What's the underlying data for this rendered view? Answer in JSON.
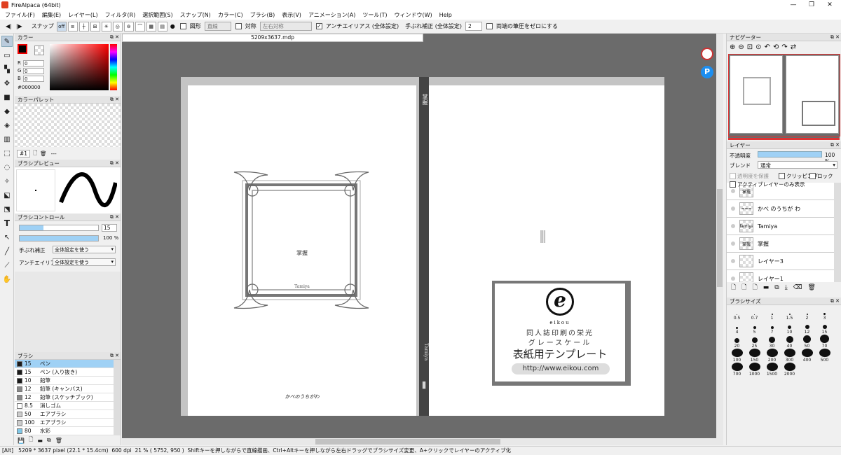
{
  "window": {
    "title": "FireAlpaca (64bit)",
    "min": "—",
    "restore": "❐",
    "close": "✕"
  },
  "menu": [
    "ファイル(F)",
    "編集(E)",
    "レイヤー(L)",
    "フィルタ(R)",
    "選択範囲(S)",
    "スナップ(N)",
    "カラー(C)",
    "ブラシ(B)",
    "表示(V)",
    "アニメーション(A)",
    "ツール(T)",
    "ウィンドウ(W)",
    "Help"
  ],
  "toolbar": {
    "snap_label": "スナップ",
    "shape_label": "図形",
    "shape_value": "直線",
    "sym_label": "対称",
    "sym_value": "左右対称",
    "aa_label": "アンチエイリアス (全体設定)",
    "stab_label": "手ぶれ補正 (全体設定)",
    "stab_value": "2",
    "pressure_label": "両端の筆圧をゼロにする"
  },
  "doc_tab": "5209x3637.mdp",
  "color_panel": {
    "title": "カラー",
    "r_label": "R",
    "r": "0",
    "g_label": "G",
    "g": "0",
    "b_label": "B",
    "b": "0",
    "hex": "#000000",
    "fg_color": "#000000"
  },
  "palette_panel": {
    "title": "カラーパレット",
    "selector": "#1",
    "name": "---"
  },
  "brush_preview": {
    "title": "ブラシプレビュー"
  },
  "brush_control": {
    "title": "ブラシコントロール",
    "size": "15",
    "opacity": "100 %",
    "size_fill": 0.3,
    "opacity_fill": 1.0,
    "stab_label": "手ぶれ補正",
    "stab_value": "全体設定を使う",
    "aa_label": "アンチエイリアス",
    "aa_value": "全体設定を使う"
  },
  "brush_panel": {
    "title": "ブラシ",
    "items": [
      {
        "size": "15",
        "name": "ペン",
        "color": "#1a1a1a",
        "selected": true
      },
      {
        "size": "15",
        "name": "ペン (入り抜き)",
        "color": "#1a1a1a"
      },
      {
        "size": "10",
        "name": "鉛筆",
        "color": "#1a1a1a"
      },
      {
        "size": "12",
        "name": "鉛筆 (キャンバス)",
        "color": "#888888"
      },
      {
        "size": "12",
        "name": "鉛筆 (スケッチブック)",
        "color": "#888888"
      },
      {
        "size": "8.5",
        "name": "消しゴム",
        "color": "#ffffff"
      },
      {
        "size": "50",
        "name": "エアブラシ",
        "color": "#cccccc"
      },
      {
        "size": "100",
        "name": "エアブラシ",
        "color": "#cccccc"
      },
      {
        "size": "80",
        "name": "水彩",
        "color": "#7fc8e8"
      }
    ]
  },
  "canvas": {
    "spine_title": "掌握",
    "spine_author": "Tamiya",
    "front_title": "掌握",
    "front_author": "Tamiya",
    "signature": "かべのうちがわ",
    "eikou_brand": "eikou",
    "eikou_line1": "同人誌印刷の栄光",
    "eikou_line2": "グレースケール",
    "eikou_line3": "表紙用テンプレート",
    "eikou_url": "http://www.eikou.com",
    "barcode_mark": "⫼"
  },
  "navigator": {
    "title": "ナビゲーター",
    "buttons": [
      "zoom-in",
      "zoom-out",
      "zoom-fit",
      "zoom-actual",
      "rotate-left",
      "rotate-reset",
      "rotate-right",
      "flip"
    ],
    "glyphs": [
      "⊕",
      "⊖",
      "⊡",
      "⊙",
      "↶",
      "⟲",
      "↷",
      "⇄"
    ]
  },
  "layer_panel": {
    "title": "レイヤー",
    "opacity_label": "不透明度",
    "opacity_value": "100 %",
    "blend_label": "ブレンド",
    "blend_value": "通常",
    "protect_label": "透明度を保護",
    "clip_label": "クリッピング",
    "lock_label": "ロック",
    "active_only_label": "アクティブレイヤーのみ表示",
    "layers": [
      {
        "name": "",
        "thumb": "掌握"
      },
      {
        "name": "かべ のうちが わ",
        "thumb": "≈≈≈"
      },
      {
        "name": "Tamiya",
        "thumb": "Tamiya"
      },
      {
        "name": "掌握",
        "thumb": "掌握"
      },
      {
        "name": "レイヤー3",
        "thumb": ""
      },
      {
        "name": "レイヤー1",
        "thumb": ""
      }
    ]
  },
  "brush_size_panel": {
    "title": "ブラシサイズ",
    "sizes": [
      "0.5",
      "0.7",
      "1",
      "1.5",
      "2",
      "3",
      "4",
      "5",
      "7",
      "10",
      "12",
      "15",
      "20",
      "25",
      "30",
      "40",
      "50",
      "70",
      "100",
      "150",
      "200",
      "300",
      "400",
      "500",
      "700",
      "1000",
      "1500",
      "2000"
    ]
  },
  "status": {
    "mode": "[Alt]",
    "size": "5209 * 3637 pixel",
    "cm": "(22.1 * 15.4cm)",
    "dpi": "600 dpi",
    "zoom": "21 %",
    "coords": "( 5752, 950 )",
    "hint": "Shiftキーを押しながらで直線描画、Ctrl+Altキーを押しながら左右ドラッグでブラシサイズ変更、A+クリックでレイヤーのアクティブ化"
  }
}
